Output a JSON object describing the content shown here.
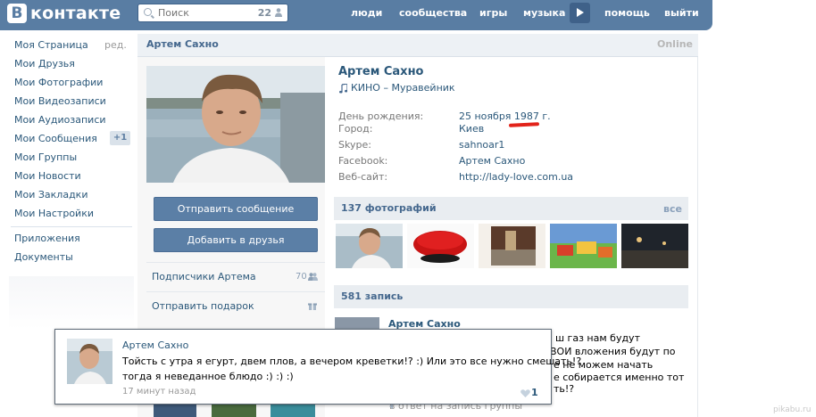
{
  "header": {
    "logo_letter": "В",
    "logo_text": "контакте",
    "search_placeholder": "Поиск",
    "search_count": "22",
    "nav": [
      "люди",
      "сообщества",
      "игры",
      "музыка",
      "помощь",
      "выйти"
    ]
  },
  "menu": {
    "items": [
      "Моя Страница",
      "Мои Друзья",
      "Мои Фотографии",
      "Мои Видеозаписи",
      "Мои Аудиозаписи",
      "Мои Сообщения",
      "Мои Группы",
      "Мои Новости",
      "Мои Закладки",
      "Мои Настройки"
    ],
    "edit_label": "ред.",
    "messages_badge": "+1",
    "extra_items": [
      "Приложения",
      "Документы"
    ]
  },
  "panel": {
    "title": "Артем Сахно",
    "online_label": "Online"
  },
  "left_column": {
    "send_message_label": "Отправить сообщение",
    "add_friend_label": "Добавить в друзья",
    "followers_label": "Подписчики Артема",
    "followers_count": "70",
    "send_gift_label": "Отправить подарок"
  },
  "profile": {
    "name": "Артем Сахно",
    "status": "КИНО – Муравейник",
    "fields": [
      {
        "label": "День рождения:",
        "value": "25 ноября 1987 г."
      },
      {
        "label": "Город:",
        "value": "Киев"
      },
      {
        "label": "Skype:",
        "value": "sahnoar1"
      },
      {
        "label": "Facebook:",
        "value": "Артем Сахно"
      },
      {
        "label": "Веб-сайт:",
        "value": "http://lady-love.com.ua"
      }
    ]
  },
  "photos": {
    "title": "137 фотографий",
    "all_label": "все"
  },
  "wall": {
    "title": "581 запись",
    "post_author": "Артем Сахно",
    "post_lines": [
      "ш газ нам будут",
      "ВОИ вложения будут по",
      "е не можем начать",
      "е собирается именно тот",
      "ть!?"
    ],
    "reply_link": "в ответ на запись группы"
  },
  "popup": {
    "author": "Артем Сахно",
    "text_line1": "Тойсть с утра я егурт, двем плов, а вечером креветки!? :) Или это все нужно смешать!?",
    "text_line2": "тогда я неведанное блюдо :) :) :)",
    "time": "17 минут назад",
    "likes": "1"
  },
  "watermark": "pikabu.ru",
  "colors": {
    "header_bg": "#597da3",
    "link": "#2b587a",
    "button": "#5b7fa6",
    "section_bg": "#e9edf1",
    "underline_red": "#e2231a"
  }
}
